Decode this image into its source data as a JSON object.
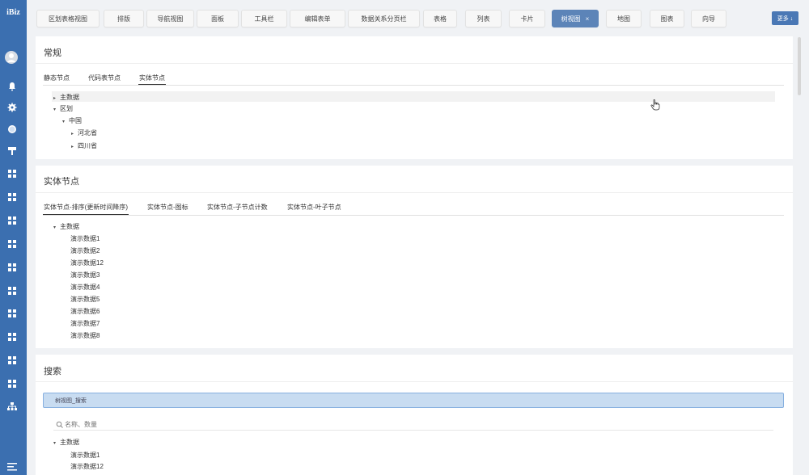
{
  "app": {
    "logo": "iBiz"
  },
  "tabs": [
    {
      "label": "区划表格视图",
      "active": false
    },
    {
      "label": "排版",
      "active": false
    },
    {
      "label": "导航视图",
      "active": false
    },
    {
      "label": "面板",
      "active": false
    },
    {
      "label": "工具栏",
      "active": false
    },
    {
      "label": "编辑表单",
      "active": false
    },
    {
      "label": "数据关系分页栏",
      "active": false
    },
    {
      "label": "表格",
      "active": false
    },
    {
      "label": "列表",
      "active": false
    },
    {
      "label": "卡片",
      "active": false
    },
    {
      "label": "树视图",
      "active": true,
      "close": "×"
    },
    {
      "label": "地图",
      "active": false
    },
    {
      "label": "图表",
      "active": false
    },
    {
      "label": "向导",
      "active": false
    }
  ],
  "more_button": "更多 ↓",
  "sidebar": {
    "icons": [
      "user-avatar-icon",
      "bell-icon",
      "gear-icon",
      "globe-icon",
      "paint-roller-icon",
      "grid-icon",
      "grid-icon",
      "grid-icon",
      "grid-icon",
      "grid-icon",
      "grid-icon",
      "grid-icon",
      "grid-icon",
      "grid-icon",
      "sitemap-icon",
      "menu-icon"
    ]
  },
  "panel1": {
    "title": "常规",
    "tabs": [
      "静态节点",
      "代码表节点",
      "实体节点"
    ],
    "active_tab": 2,
    "tree": [
      {
        "caret": "▸",
        "label": "主数据"
      },
      {
        "caret": "▾",
        "label": "区划"
      },
      {
        "caret": "▾",
        "label": "中国"
      },
      {
        "caret": "▸",
        "label": "河北省"
      },
      {
        "caret": "▸",
        "label": "四川省"
      }
    ]
  },
  "panel2": {
    "title": "实体节点",
    "tabs": [
      "实体节点-排序(更新时间降序)",
      "实体节点-图标",
      "实体节点-子节点计数",
      "实体节点-叶子节点"
    ],
    "active_tab": 0,
    "root": {
      "caret": "▾",
      "label": "主数据"
    },
    "items": [
      "演示数据1",
      "演示数据2",
      "演示数据12",
      "演示数据3",
      "演示数据4",
      "演示数据5",
      "演示数据6",
      "演示数据7",
      "演示数据8"
    ]
  },
  "panel3": {
    "title": "搜索",
    "search_box_label": "树视图_搜索",
    "search_placeholder": "名称、数量",
    "root": {
      "caret": "▾",
      "label": "主数据"
    },
    "items": [
      "演示数据1",
      "演示数据12"
    ]
  },
  "colors": {
    "sidebar": "#3b6fb0",
    "active_tab": "#5c84b8",
    "search_box": "#c8dcf1"
  }
}
